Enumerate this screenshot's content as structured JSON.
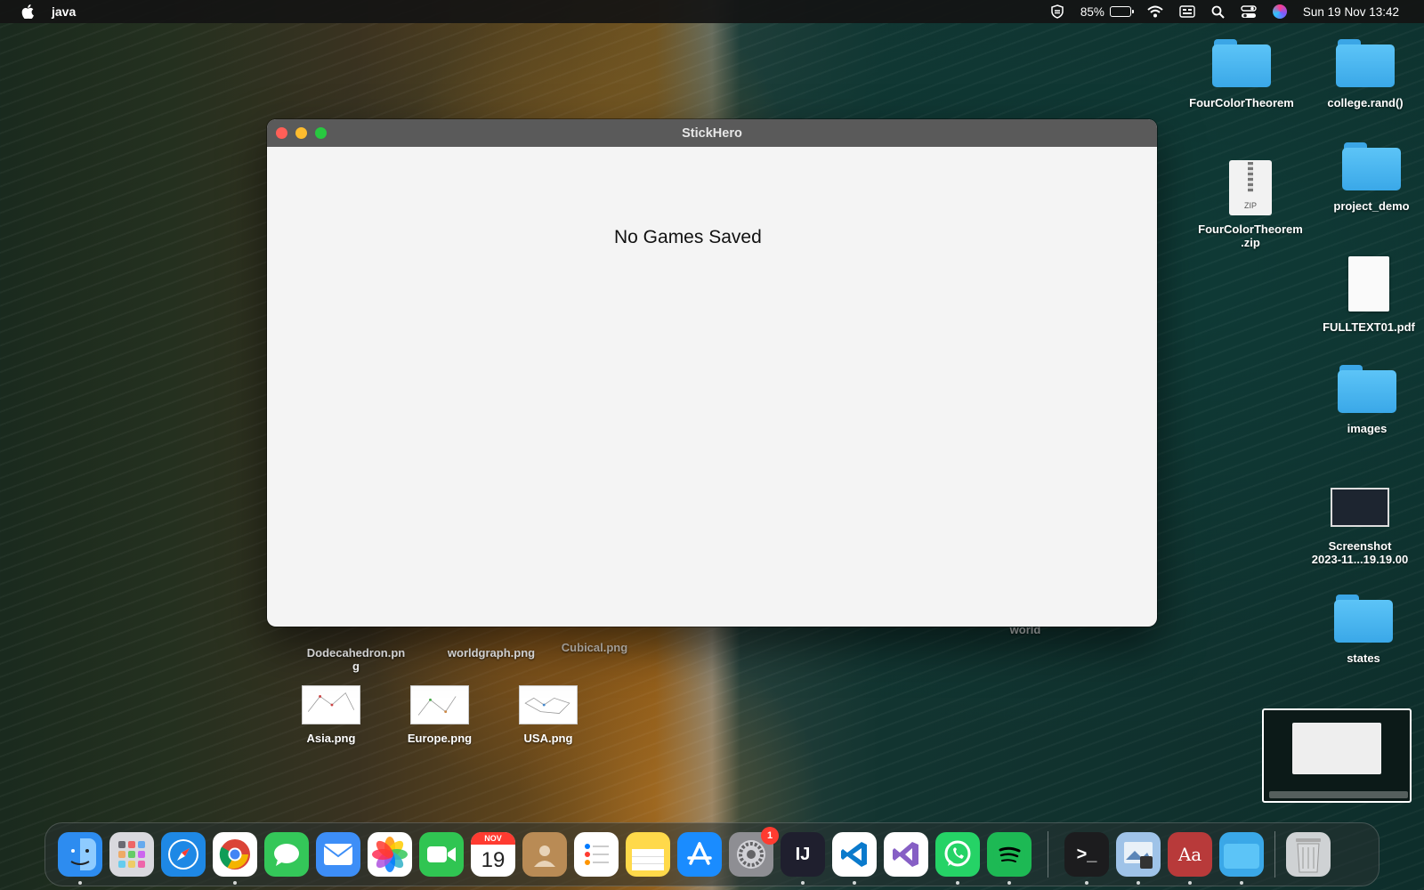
{
  "menubar": {
    "app_name": "java",
    "battery_percent": "85%",
    "battery_level": 0.85,
    "datetime": "Sun 19 Nov  13:42"
  },
  "window": {
    "title": "StickHero",
    "message": "No Games Saved"
  },
  "desktop": {
    "right_icons": [
      {
        "label": "FourColorTheorem",
        "type": "folder"
      },
      {
        "label": "college.rand()",
        "type": "folder"
      },
      {
        "label": "FourColorTheorem.zip",
        "type": "zip",
        "line1": "FourColorTheorem",
        "line2": ".zip"
      },
      {
        "label": "project_demo",
        "type": "folder"
      },
      {
        "label": "FULLTEXT01.pdf",
        "type": "pdf"
      },
      {
        "label": "images",
        "type": "folder"
      },
      {
        "label": "Screenshot 2023-11...19.19.00",
        "type": "screenshot",
        "line1": "Screenshot",
        "line2": "2023-11...19.19.00"
      },
      {
        "label": "states",
        "type": "folder"
      }
    ],
    "partial_labels": {
      "dodecahedron_line1": "Dodecahedron.pn",
      "dodecahedron_line2": "g",
      "worldgraph": "worldgraph.png",
      "cubical": "Cubical.png",
      "world": "world"
    },
    "image_files": [
      "Asia.png",
      "Europe.png",
      "USA.png"
    ],
    "zip_badge": "ZIP"
  },
  "dock": {
    "apps": [
      {
        "name": "Finder",
        "icon": "finder-icon",
        "color": "#2d8cf0",
        "running": true
      },
      {
        "name": "Launchpad",
        "icon": "launchpad-icon",
        "color": "#d9d9de",
        "running": false
      },
      {
        "name": "Safari",
        "icon": "safari-icon",
        "color": "#1e88e5",
        "running": false
      },
      {
        "name": "Chrome",
        "icon": "chrome-icon",
        "color": "#ffffff",
        "running": true
      },
      {
        "name": "Messages",
        "icon": "messages-icon",
        "color": "#34c759",
        "running": false
      },
      {
        "name": "Mail",
        "icon": "mail-icon",
        "color": "#3d8ef7",
        "running": false
      },
      {
        "name": "Photos",
        "icon": "photos-icon",
        "color": "#ffffff",
        "running": false
      },
      {
        "name": "FaceTime",
        "icon": "facetime-icon",
        "color": "#30c552",
        "running": false
      },
      {
        "name": "Calendar",
        "icon": "calendar-icon",
        "color": "#ffffff",
        "running": false,
        "month": "NOV",
        "day": "19"
      },
      {
        "name": "Contacts",
        "icon": "contacts-icon",
        "color": "#b98b55",
        "running": false
      },
      {
        "name": "Reminders",
        "icon": "reminders-icon",
        "color": "#ffffff",
        "running": false
      },
      {
        "name": "Notes",
        "icon": "notes-icon",
        "color": "#ffd94a",
        "running": false
      },
      {
        "name": "App Store",
        "icon": "appstore-icon",
        "color": "#1a8cff",
        "running": false
      },
      {
        "name": "System Settings",
        "icon": "settings-icon",
        "color": "#8e8e93",
        "running": false,
        "badge": "1"
      },
      {
        "name": "IntelliJ IDEA",
        "icon": "intellij-icon",
        "color": "#1f1f2e",
        "running": true,
        "text": "IJ"
      },
      {
        "name": "VS Code",
        "icon": "vscode-icon",
        "color": "#ffffff",
        "running": true
      },
      {
        "name": "Visual Studio",
        "icon": "visualstudio-icon",
        "color": "#ffffff",
        "running": false
      },
      {
        "name": "WhatsApp",
        "icon": "whatsapp-icon",
        "color": "#25d366",
        "running": true
      },
      {
        "name": "Spotify",
        "icon": "spotify-icon",
        "color": "#1db954",
        "running": true
      }
    ],
    "right_apps": [
      {
        "name": "Terminal",
        "icon": "terminal-icon",
        "color": "#1c1c1e",
        "running": true,
        "text": ">_"
      },
      {
        "name": "Preview",
        "icon": "preview-icon",
        "color": "#9fc3e8",
        "running": true
      },
      {
        "name": "Dictionary",
        "icon": "dictionary-icon",
        "color": "#b83a3a",
        "running": true,
        "text": "Aa"
      },
      {
        "name": "Downloads",
        "icon": "folder-icon",
        "color": "#3aa8e8",
        "running": true
      },
      {
        "name": "Trash",
        "icon": "trash-icon",
        "color": "#cfd2d4",
        "running": false
      }
    ]
  }
}
